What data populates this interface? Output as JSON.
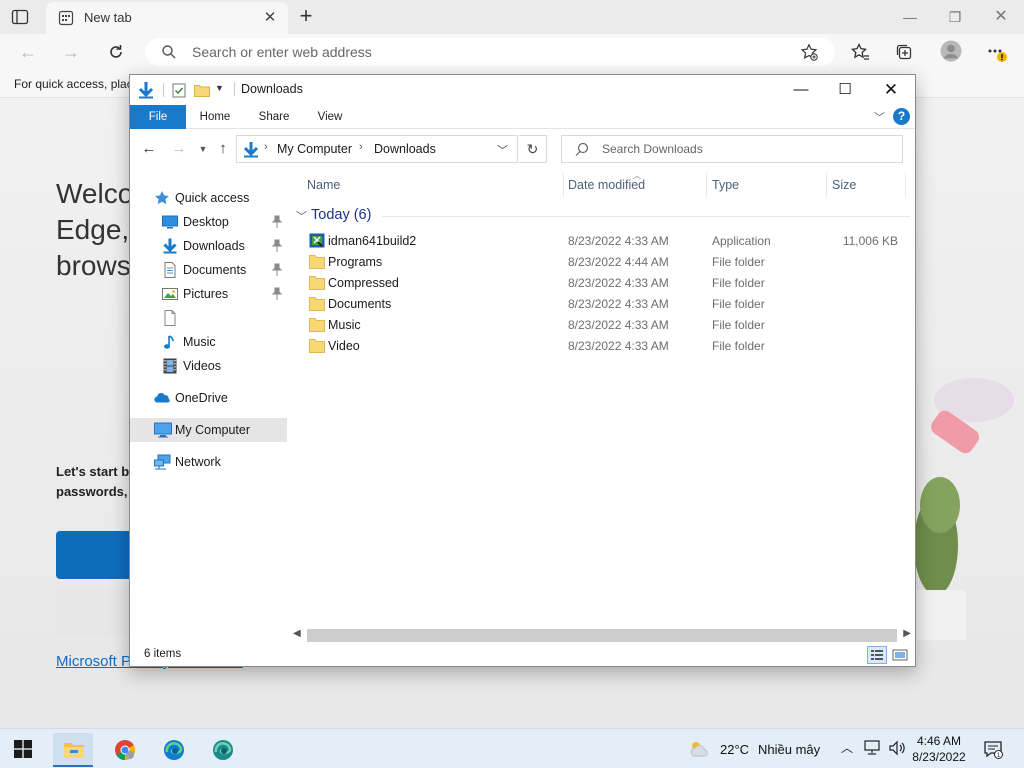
{
  "browser": {
    "tab_title": "New tab",
    "address_placeholder": "Search or enter web address",
    "favorites_hint": "For quick access, place your favorites here on the favorites bar."
  },
  "edge_page": {
    "welcome_lines": [
      "Welcome to Microsoft",
      "Edge, the browser",
      "browser"
    ],
    "welcome_l1": "Welco",
    "welcome_l2": "Edge,",
    "welcome_l3": "brows",
    "lets_start_l1": "Let's start b",
    "lets_start_l2": "passwords,",
    "privacy_link": "Microsoft Privacy Statement"
  },
  "explorer": {
    "title": "Downloads",
    "ribbon_tabs": {
      "file": "File",
      "home": "Home",
      "share": "Share",
      "view": "View"
    },
    "path": {
      "root": "My Computer",
      "current": "Downloads"
    },
    "search_placeholder": "Search Downloads",
    "sidebar": {
      "quick_access": "Quick access",
      "desktop": "Desktop",
      "downloads": "Downloads",
      "documents": "Documents",
      "pictures": "Pictures",
      "music": "Music",
      "videos": "Videos",
      "onedrive": "OneDrive",
      "my_computer": "My Computer",
      "network": "Network"
    },
    "columns": {
      "name": "Name",
      "date": "Date modified",
      "type": "Type",
      "size": "Size"
    },
    "group_label": "Today (6)",
    "files": [
      {
        "name": "idman641build2",
        "date": "8/23/2022 4:33 AM",
        "type": "Application",
        "size": "11,006 KB",
        "icon": "installer-icon"
      },
      {
        "name": "Programs",
        "date": "8/23/2022 4:44 AM",
        "type": "File folder",
        "size": "",
        "icon": "folder-icon"
      },
      {
        "name": "Compressed",
        "date": "8/23/2022 4:33 AM",
        "type": "File folder",
        "size": "",
        "icon": "folder-icon"
      },
      {
        "name": "Documents",
        "date": "8/23/2022 4:33 AM",
        "type": "File folder",
        "size": "",
        "icon": "folder-icon"
      },
      {
        "name": "Music",
        "date": "8/23/2022 4:33 AM",
        "type": "File folder",
        "size": "",
        "icon": "folder-icon"
      },
      {
        "name": "Video",
        "date": "8/23/2022 4:33 AM",
        "type": "File folder",
        "size": "",
        "icon": "folder-icon"
      }
    ],
    "status_count": "6 items"
  },
  "taskbar": {
    "temperature": "22°C",
    "condition": "Nhiều mây",
    "time": "4:46 AM",
    "date": "8/23/2022"
  },
  "colors": {
    "accent": "#1979ca",
    "folder": "#f8d775",
    "selection": "#e5e5e5"
  }
}
